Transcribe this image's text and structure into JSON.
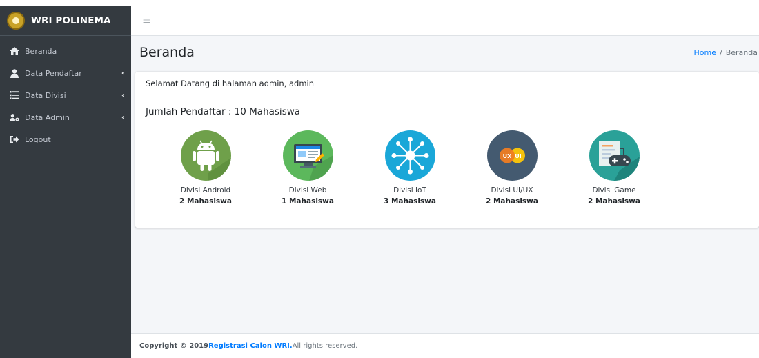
{
  "brand": {
    "title": "WRI POLINEMA"
  },
  "sidebar": {
    "items": [
      {
        "label": "Beranda",
        "icon": "home-icon"
      },
      {
        "label": "Data Pendaftar",
        "icon": "user-icon",
        "chevron": "‹"
      },
      {
        "label": "Data Divisi",
        "icon": "list-icon",
        "chevron": "‹"
      },
      {
        "label": "Data Admin",
        "icon": "users-cog-icon",
        "chevron": "‹"
      },
      {
        "label": "Logout",
        "icon": "sign-out-icon"
      }
    ]
  },
  "topbar": {
    "menu_icon": "≡"
  },
  "header": {
    "title": "Beranda"
  },
  "breadcrumb": {
    "home": "Home",
    "separator": "/",
    "current": "Beranda"
  },
  "card": {
    "welcome": "Selamat Datang di halaman admin, admin",
    "count_title": "Jumlah Pendaftar : 10 Mahasiswa"
  },
  "divisi": [
    {
      "name": "Divisi Android",
      "count": "2 Mahasiswa",
      "color": "#6fa04a",
      "icon": "android-icon"
    },
    {
      "name": "Divisi Web",
      "count": "1 Mahasiswa",
      "color": "#5cb85c",
      "icon": "web-monitor-icon"
    },
    {
      "name": "Divisi IoT",
      "count": "3 Mahasiswa",
      "color": "#1aa7d8",
      "icon": "iot-network-icon"
    },
    {
      "name": "Divisi UI/UX",
      "count": "2 Mahasiswa",
      "color": "#445a70",
      "icon": "uiux-icon",
      "badge_left": "UX",
      "badge_right": "UI"
    },
    {
      "name": "Divisi Game",
      "count": "2 Mahasiswa",
      "color": "#2aa198",
      "icon": "gamepad-icon"
    }
  ],
  "footer": {
    "prefix": "Copyright © 2019 ",
    "link": "Registrasi Calon WRI.",
    "suffix": " All rights reserved."
  }
}
